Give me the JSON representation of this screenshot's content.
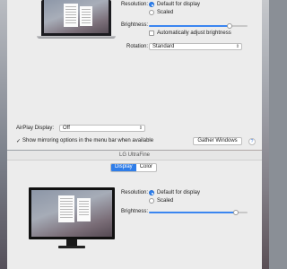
{
  "top": {
    "resolution_label": "Resolution:",
    "res_default": "Default for display",
    "res_scaled": "Scaled",
    "brightness_label": "Brightness:",
    "brightness_level": 0.82,
    "auto_brightness": "Automatically adjust brightness",
    "rotation_label": "Rotation:",
    "rotation_value": "Standard",
    "airplay_label": "AirPlay Display:",
    "airplay_value": "Off",
    "mirroring_option": "Show mirroring options in the menu bar when available",
    "gather_button": "Gather Windows",
    "help_glyph": "?"
  },
  "bottom": {
    "title": "LG UltraFine",
    "tabs": [
      "Display",
      "Color"
    ],
    "resolution_label": "Resolution:",
    "res_default": "Default for display",
    "res_scaled": "Scaled",
    "brightness_label": "Brightness:",
    "brightness_level": 0.88
  },
  "colors": {
    "accent": "#2f7de8",
    "window_bg": "#ececec"
  }
}
